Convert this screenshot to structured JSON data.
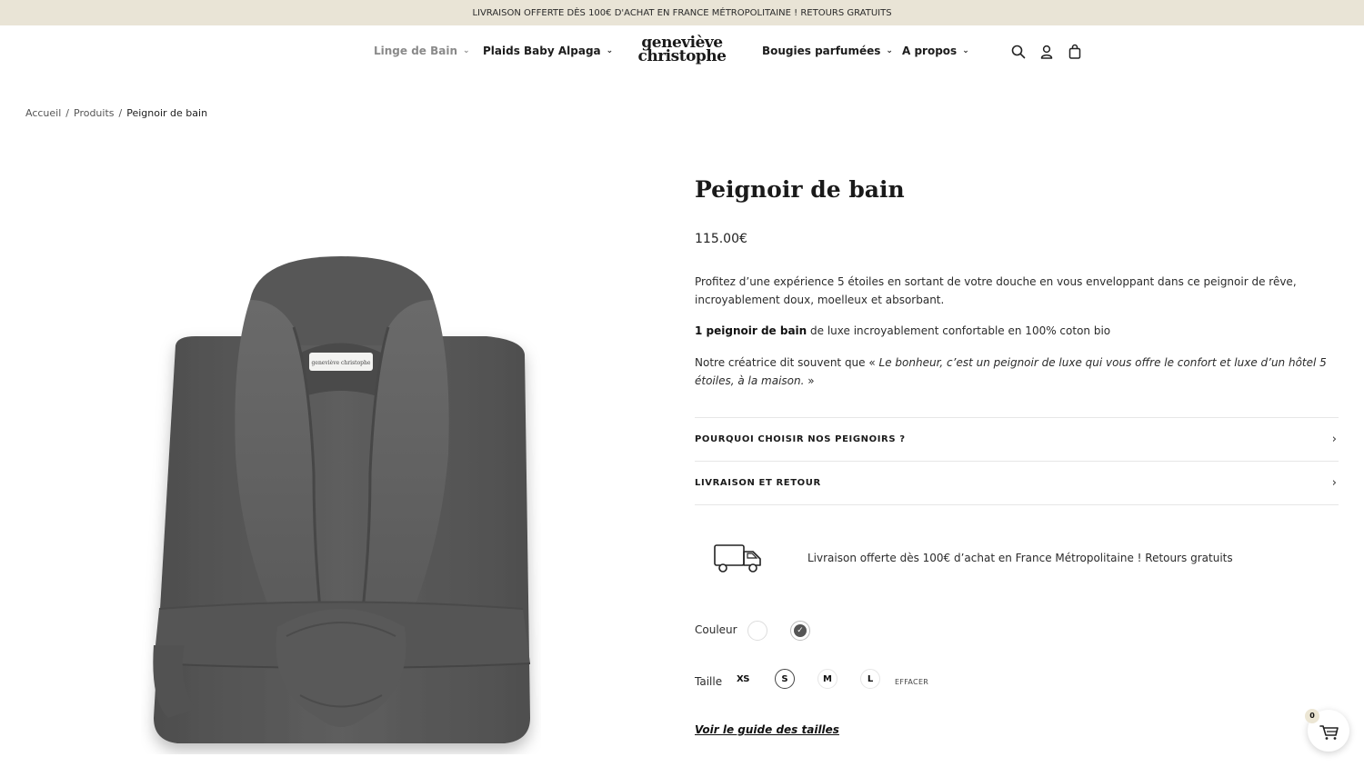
{
  "topbar": {
    "text": "LIVRAISON OFFERTE DÈS 100€ D'ACHAT EN FRANCE MÉTROPOLITAINE ! RETOURS GRATUITS"
  },
  "nav": {
    "items": [
      {
        "label": "Linge de Bain"
      },
      {
        "label": "Plaids Baby Alpaga"
      },
      {
        "label": "Bougies parfumées"
      },
      {
        "label": "A propos"
      }
    ],
    "logo_line1": "geneviève",
    "logo_line2": "christophe",
    "icons": [
      "search-icon",
      "account-icon",
      "bag-icon"
    ]
  },
  "breadcrumb": {
    "home": "Accueil",
    "sep1": "/",
    "products": "Produits",
    "sep2": "/",
    "current": "Peignoir de bain"
  },
  "product": {
    "title": "Peignoir de bain",
    "price": "115.00€",
    "desc1": "Profitez d’une expérience 5 étoiles en sortant de votre douche en vous enveloppant dans ce peignoir de rêve, incroyablement doux, moelleux et absorbant.",
    "desc2_bold": "1 peignoir de bain",
    "desc2_rest": " de luxe incroyablement confortable en 100% coton bio",
    "desc3_start": "Notre créatrice dit souvent que « ",
    "desc3_quote": "Le bonheur, c’est un peignoir de luxe qui vous offre le confort et luxe d’un hôtel 5 étoiles, à la maison.",
    "desc3_end": " »",
    "label_tag": "geneviève christophe",
    "accordion": [
      {
        "label": "POURQUOI CHOISIR NOS PEIGNOIRS ?"
      },
      {
        "label": "LIVRAISON ET RETOUR"
      }
    ],
    "shipping_text": "Livraison offerte dès 100€ d’achat en France Métropolitaine ! Retours gratuits",
    "color_label": "Couleur",
    "colors": [
      {
        "name": "white",
        "hex": "#ffffff",
        "selected": false
      },
      {
        "name": "grey",
        "hex": "#555555",
        "selected": true
      }
    ],
    "size_label": "Taille",
    "sizes": [
      {
        "label": "XS",
        "selected": false
      },
      {
        "label": "S",
        "selected": true
      },
      {
        "label": "M",
        "selected": false
      },
      {
        "label": "L",
        "selected": false
      }
    ],
    "clear_label": "EFFACER",
    "guide_label": "Voir le guide des tailles"
  },
  "cart": {
    "count": "0"
  },
  "colors": {
    "topbar_bg": "#e9e4d6",
    "robe": "#5a5a5a",
    "text": "#1f1f1f"
  }
}
